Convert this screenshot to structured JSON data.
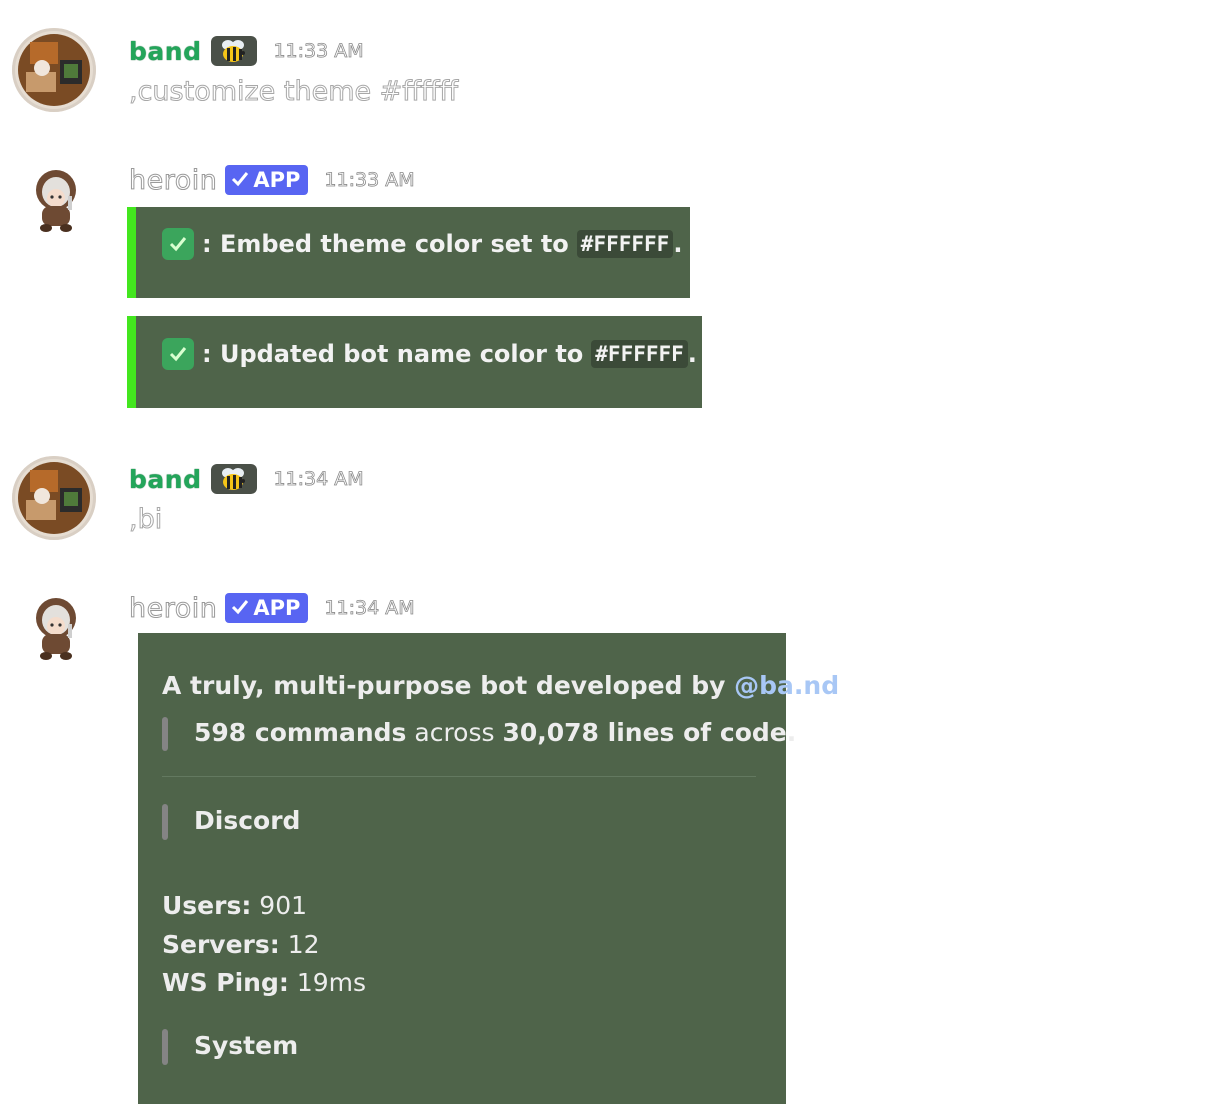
{
  "messages": [
    {
      "author": "band",
      "badge_icon": "bee-emoji",
      "time": "11:33 AM",
      "content": ",customize theme #ffffff"
    },
    {
      "author": "heroin",
      "app_badge": "APP",
      "time": "11:33 AM",
      "embeds": [
        {
          "prefix": ": Embed theme color set to",
          "code": "#FFFFFF",
          "suffix": "."
        },
        {
          "prefix": ": Updated bot name color to",
          "code": "#FFFFFF",
          "suffix": "."
        }
      ]
    },
    {
      "author": "band",
      "badge_icon": "bee-emoji",
      "time": "11:34 AM",
      "content": ",bi"
    },
    {
      "author": "heroin",
      "app_badge": "APP",
      "time": "11:34 AM",
      "info_embed": {
        "description_prefix": "A truly, multi-purpose bot developed by",
        "mention": "@ba.nd",
        "commands_count": "598 commands",
        "across": "across",
        "lines": "30,078 lines of code.",
        "section_discord": "Discord",
        "users_label": "Users:",
        "users_value": "901",
        "servers_label": "Servers:",
        "servers_value": "12",
        "ping_label": "WS Ping:",
        "ping_value": "19ms",
        "section_system": "System"
      }
    }
  ],
  "colors": {
    "embed_bg": "#4f644a",
    "embed_accent": "#43e61e",
    "band_name": "#23a55a",
    "app_badge": "#5865f2",
    "mention": "#a8c7f5"
  }
}
